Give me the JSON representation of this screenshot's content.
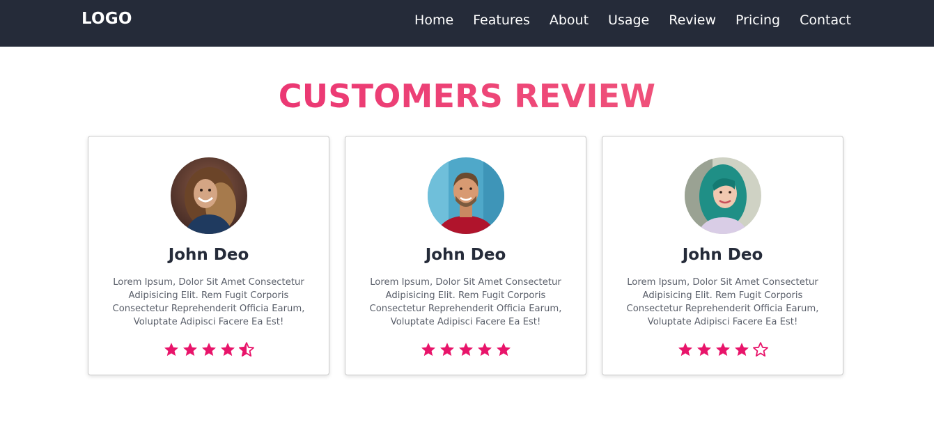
{
  "nav": {
    "logo": "LOGO",
    "items": [
      {
        "label": "Home"
      },
      {
        "label": "Features"
      },
      {
        "label": "About"
      },
      {
        "label": "Usage"
      },
      {
        "label": "Review"
      },
      {
        "label": "Pricing"
      },
      {
        "label": "Contact"
      }
    ]
  },
  "section": {
    "title": "CUSTOMERS REVIEW"
  },
  "reviews": [
    {
      "name": "John Deo",
      "text": "Lorem Ipsum, Dolor Sit Amet Consectetur Adipisicing Elit. Rem Fugit Corporis Consectetur Reprehenderit Officia Earum, Voluptate Adipisci Facere Ea Est!",
      "rating": 4.5
    },
    {
      "name": "John Deo",
      "text": "Lorem Ipsum, Dolor Sit Amet Consectetur Adipisicing Elit. Rem Fugit Corporis Consectetur Reprehenderit Officia Earum, Voluptate Adipisci Facere Ea Est!",
      "rating": 5
    },
    {
      "name": "John Deo",
      "text": "Lorem Ipsum, Dolor Sit Amet Consectetur Adipisicing Elit. Rem Fugit Corporis Consectetur Reprehenderit Officia Earum, Voluptate Adipisci Facere Ea Est!",
      "rating": 4
    }
  ],
  "colors": {
    "navbar_bg": "#252b39",
    "accent": "#e8146a",
    "title_gradient_start": "#e8246d",
    "title_gradient_end": "#f26480"
  }
}
